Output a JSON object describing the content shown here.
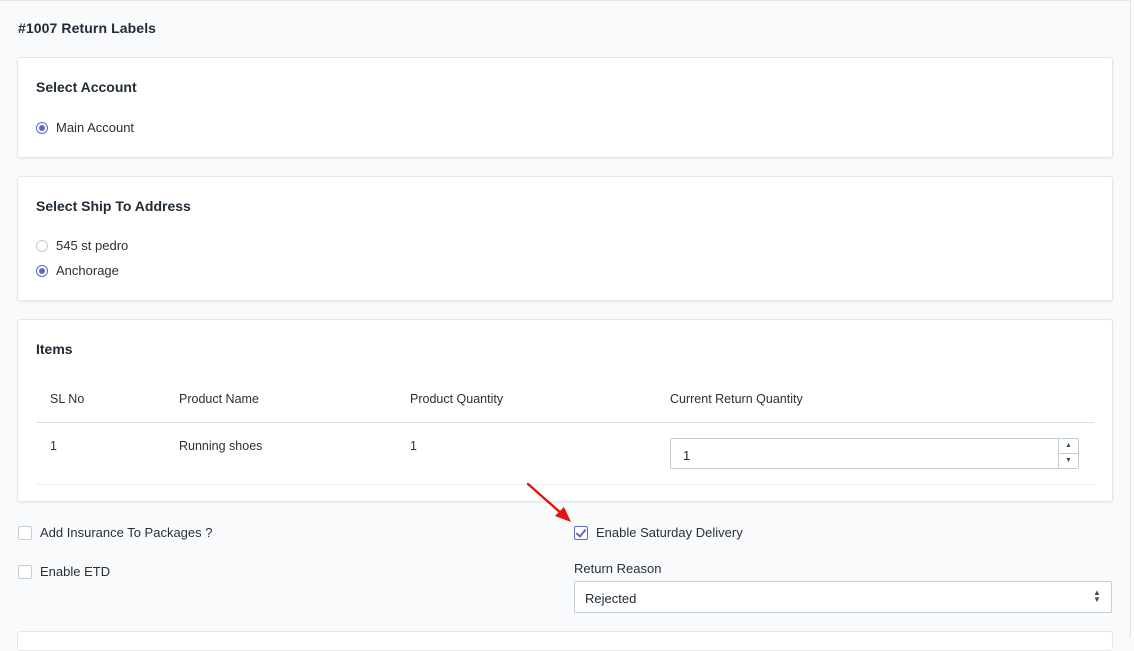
{
  "page": {
    "title": "#1007 Return Labels"
  },
  "account_section": {
    "title": "Select Account",
    "options": [
      {
        "label": "Main Account",
        "selected": true
      }
    ]
  },
  "address_section": {
    "title": "Select Ship To Address",
    "options": [
      {
        "label": "545 st pedro",
        "selected": false
      },
      {
        "label": "Anchorage",
        "selected": true
      }
    ]
  },
  "items_section": {
    "title": "Items",
    "columns": [
      "SL No",
      "Product Name",
      "Product Quantity",
      "Current Return Quantity"
    ],
    "rows": [
      {
        "sl_no": "1",
        "product_name": "Running shoes",
        "product_quantity": "1",
        "return_quantity": "1"
      }
    ]
  },
  "options": {
    "insurance": {
      "label": "Add Insurance To Packages ?",
      "checked": false
    },
    "etd": {
      "label": "Enable ETD",
      "checked": false
    },
    "saturday_delivery": {
      "label": "Enable Saturday Delivery",
      "checked": true
    }
  },
  "return_reason": {
    "label": "Return Reason",
    "value": "Rejected"
  },
  "icons": {
    "spinner_up": "chevron-up-icon",
    "spinner_down": "chevron-down-icon",
    "select_caret": "select-caret-icon",
    "annotation": "red-arrow-icon"
  },
  "colors": {
    "accent": "#5c6ac4",
    "annotation": "#e3140f"
  }
}
